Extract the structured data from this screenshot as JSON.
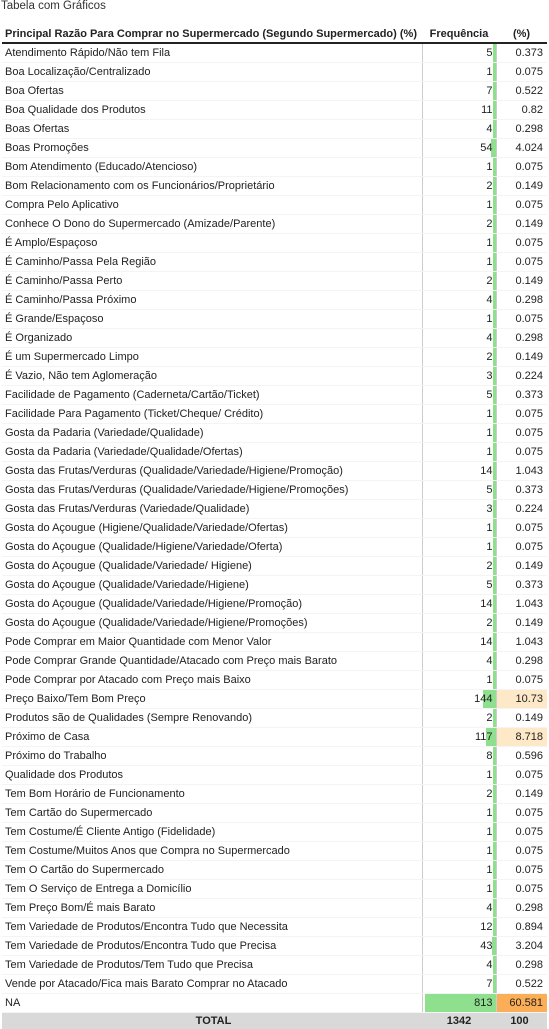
{
  "window_title": "Tabela com Gráficos",
  "table": {
    "headers": {
      "label": "Principal Razão Para Comprar no Supermercado (Segundo Supermercado) (%)",
      "freq": "Frequência",
      "pct": "(%)"
    },
    "rows": [
      {
        "label": "Atendimento Rápido/Não tem Fila",
        "freq": "5",
        "pct": "0.373"
      },
      {
        "label": "Boa Localização/Centralizado",
        "freq": "1",
        "pct": "0.075"
      },
      {
        "label": "Boa Ofertas",
        "freq": "7",
        "pct": "0.522"
      },
      {
        "label": "Boa Qualidade dos Produtos",
        "freq": "11",
        "pct": "0.82"
      },
      {
        "label": "Boas Ofertas",
        "freq": "4",
        "pct": "0.298"
      },
      {
        "label": "Boas Promoções",
        "freq": "54",
        "pct": "4.024"
      },
      {
        "label": "Bom Atendimento (Educado/Atencioso)",
        "freq": "1",
        "pct": "0.075"
      },
      {
        "label": "Bom Relacionamento com os Funcionários/Proprietário",
        "freq": "2",
        "pct": "0.149"
      },
      {
        "label": "Compra Pelo Aplicativo",
        "freq": "1",
        "pct": "0.075"
      },
      {
        "label": "Conhece O Dono do Supermercado (Amizade/Parente)",
        "freq": "2",
        "pct": "0.149"
      },
      {
        "label": "É Amplo/Espaçoso",
        "freq": "1",
        "pct": "0.075"
      },
      {
        "label": "É Caminho/Passa Pela Região",
        "freq": "1",
        "pct": "0.075"
      },
      {
        "label": "É Caminho/Passa Perto",
        "freq": "2",
        "pct": "0.149"
      },
      {
        "label": "É Caminho/Passa Próximo",
        "freq": "4",
        "pct": "0.298"
      },
      {
        "label": "É Grande/Espaçoso",
        "freq": "1",
        "pct": "0.075"
      },
      {
        "label": "É Organizado",
        "freq": "4",
        "pct": "0.298"
      },
      {
        "label": "É um Supermercado Limpo",
        "freq": "2",
        "pct": "0.149"
      },
      {
        "label": "É Vazio, Não tem Aglomeração",
        "freq": "3",
        "pct": "0.224"
      },
      {
        "label": "Facilidade de Pagamento (Caderneta/Cartão/Ticket)",
        "freq": "5",
        "pct": "0.373"
      },
      {
        "label": "Facilidade Para Pagamento (Ticket/Cheque/ Crédito)",
        "freq": "1",
        "pct": "0.075"
      },
      {
        "label": "Gosta da Padaria (Variedade/Qualidade)",
        "freq": "1",
        "pct": "0.075"
      },
      {
        "label": "Gosta da Padaria (Variedade/Qualidade/Ofertas)",
        "freq": "1",
        "pct": "0.075"
      },
      {
        "label": "Gosta das Frutas/Verduras (Qualidade/Variedade/Higiene/Promoção)",
        "freq": "14",
        "pct": "1.043"
      },
      {
        "label": "Gosta das Frutas/Verduras (Qualidade/Variedade/Higiene/Promoções)",
        "freq": "5",
        "pct": "0.373"
      },
      {
        "label": "Gosta das Frutas/Verduras (Variedade/Qualidade)",
        "freq": "3",
        "pct": "0.224"
      },
      {
        "label": "Gosta do Açougue (Higiene/Qualidade/Variedade/Ofertas)",
        "freq": "1",
        "pct": "0.075"
      },
      {
        "label": "Gosta do Açougue (Qualidade/Higiene/Variedade/Oferta)",
        "freq": "1",
        "pct": "0.075"
      },
      {
        "label": "Gosta do Açougue (Qualidade/Variedade/ Higiene)",
        "freq": "2",
        "pct": "0.149"
      },
      {
        "label": "Gosta do Açougue (Qualidade/Variedade/Higiene)",
        "freq": "5",
        "pct": "0.373"
      },
      {
        "label": "Gosta do Açougue (Qualidade/Variedade/Higiene/Promoção)",
        "freq": "14",
        "pct": "1.043"
      },
      {
        "label": "Gosta do Açougue (Qualidade/Variedade/Higiene/Promoções)",
        "freq": "2",
        "pct": "0.149"
      },
      {
        "label": "Pode Comprar em Maior Quantidade com Menor Valor",
        "freq": "14",
        "pct": "1.043"
      },
      {
        "label": "Pode Comprar Grande Quantidade/Atacado com Preço mais Barato",
        "freq": "4",
        "pct": "0.298"
      },
      {
        "label": "Pode Comprar por Atacado com Preço mais Baixo",
        "freq": "1",
        "pct": "0.075"
      },
      {
        "label": "Preço Baixo/Tem Bom Preço",
        "freq": "144",
        "pct": "10.73",
        "pct_highlight": "mid"
      },
      {
        "label": "Produtos são de Qualidades (Sempre Renovando)",
        "freq": "2",
        "pct": "0.149"
      },
      {
        "label": "Próximo de Casa",
        "freq": "117",
        "pct": "8.718",
        "pct_highlight": "mid"
      },
      {
        "label": "Próximo do Trabalho",
        "freq": "8",
        "pct": "0.596"
      },
      {
        "label": "Qualidade dos Produtos",
        "freq": "1",
        "pct": "0.075"
      },
      {
        "label": "Tem Bom Horário de Funcionamento",
        "freq": "2",
        "pct": "0.149"
      },
      {
        "label": "Tem Cartão do Supermercado",
        "freq": "1",
        "pct": "0.075"
      },
      {
        "label": "Tem Costume/É Cliente Antigo (Fidelidade)",
        "freq": "1",
        "pct": "0.075"
      },
      {
        "label": "Tem Costume/Muitos Anos que Compra no Supermercado",
        "freq": "1",
        "pct": "0.075"
      },
      {
        "label": "Tem O Cartão do Supermercado",
        "freq": "1",
        "pct": "0.075"
      },
      {
        "label": "Tem O Serviço de Entrega a Domicílio",
        "freq": "1",
        "pct": "0.075"
      },
      {
        "label": "Tem Preço Bom/É mais Barato",
        "freq": "4",
        "pct": "0.298"
      },
      {
        "label": "Tem Variedade de Produtos/Encontra Tudo que Necessita",
        "freq": "12",
        "pct": "0.894"
      },
      {
        "label": "Tem Variedade de Produtos/Encontra Tudo que Precisa",
        "freq": "43",
        "pct": "3.204"
      },
      {
        "label": "Tem Variedade de Produtos/Tem Tudo que Precisa",
        "freq": "4",
        "pct": "0.298"
      },
      {
        "label": "Vende por Atacado/Fica mais Barato Comprar no Atacado",
        "freq": "7",
        "pct": "0.522"
      },
      {
        "label": "NA",
        "freq": "813",
        "pct": "60.581",
        "pct_highlight": "max"
      }
    ],
    "total": {
      "label": "TOTAL",
      "freq": "1342",
      "pct": "100"
    }
  },
  "colors": {
    "freq_bar": "#8ee08e",
    "pct_highlight_mid": "#fde9c8",
    "pct_highlight_max": "#fbae56",
    "total_row_bg": "#d9d9d9"
  }
}
